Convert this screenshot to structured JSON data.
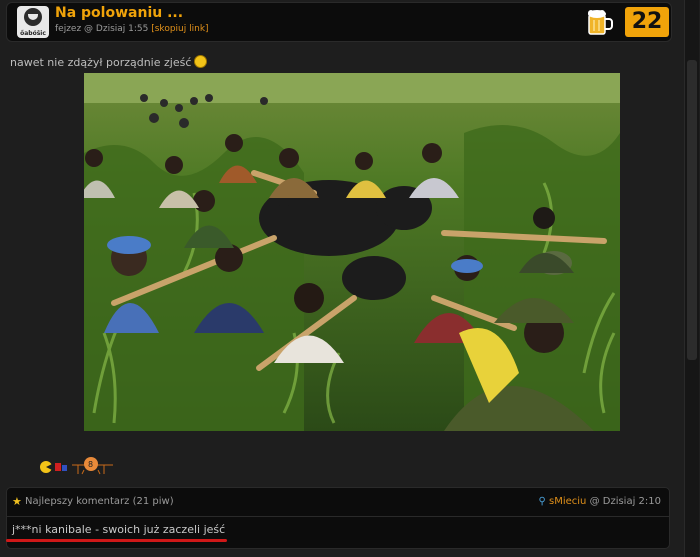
{
  "post": {
    "title": "Na polowaniu ...",
    "meta_author": "fejzez @ Dzisiaj 1:55",
    "copy_link": "[skopiuj link]",
    "score": "22",
    "avatar_label": "őabóšic",
    "caption": "nawet nie zdążył porządnie zjeść"
  },
  "photo": {
    "alt": "People carrying a dead gorilla tied to wooden poles through a green field"
  },
  "comment": {
    "best_label": "Najlepszy komentarz (21 piw)",
    "author": "sMieciu",
    "time": "@ Dzisiaj 2:10",
    "text": "j***ni kanibale - swoich już zaczeli jeść"
  },
  "colors": {
    "accent": "#f0a30a",
    "background": "#1e1e1e",
    "underline": "#d01818"
  }
}
